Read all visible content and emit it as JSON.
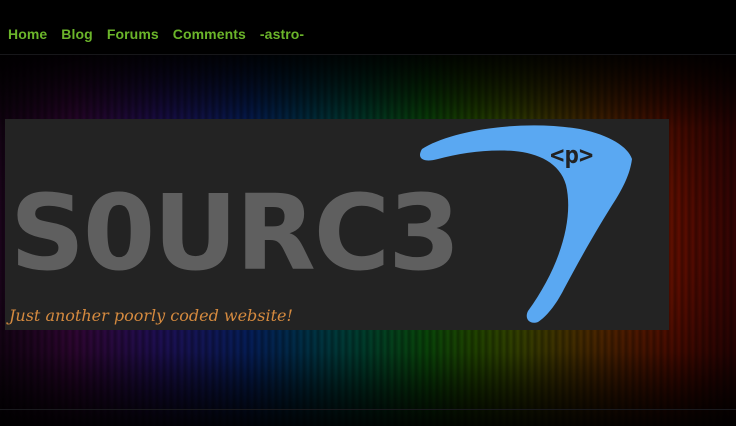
{
  "nav": {
    "items": [
      {
        "label": "Home"
      },
      {
        "label": "Blog"
      },
      {
        "label": "Forums"
      },
      {
        "label": "Comments"
      },
      {
        "label": "-astro-"
      }
    ]
  },
  "banner": {
    "logo_text": "S0URC3",
    "tag_label": "<p>",
    "tagline": "Just another poorly coded website!"
  },
  "colors": {
    "nav_link": "#6bb52a",
    "banner_bg": "#232323",
    "logo_text": "#5f5f5f",
    "boomerang": "#5aa8f2",
    "tagline": "#d58a3f"
  }
}
